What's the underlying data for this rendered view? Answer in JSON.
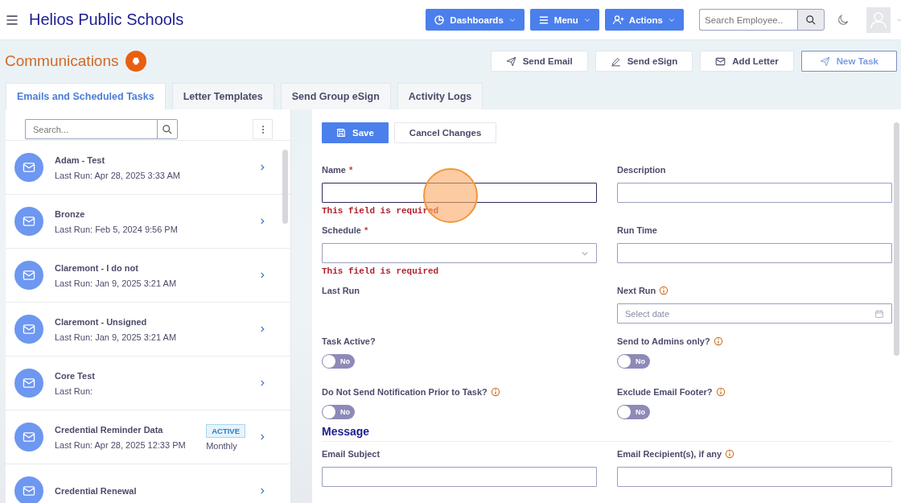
{
  "header": {
    "title": "Helios Public Schools",
    "nav_buttons": [
      {
        "kind": "dashboards",
        "label": "Dashboards"
      },
      {
        "kind": "menu",
        "label": "Menu"
      },
      {
        "kind": "actions",
        "label": "Actions"
      }
    ],
    "search": {
      "placeholder": "Search Employee.."
    }
  },
  "page": {
    "title": "Communications",
    "action_buttons": [
      {
        "kind": "send",
        "label": "Send Email",
        "highlighted": false
      },
      {
        "kind": "sign",
        "label": "Send eSign",
        "highlighted": false
      },
      {
        "kind": "mail",
        "label": "Add Letter",
        "highlighted": false
      },
      {
        "kind": "send",
        "label": "New Task",
        "highlighted": true
      }
    ],
    "tabs": [
      {
        "label": "Emails and Scheduled Tasks",
        "selected": true
      },
      {
        "label": "Letter Templates",
        "selected": false
      },
      {
        "label": "Send Group eSign",
        "selected": false
      },
      {
        "label": "Activity Logs",
        "selected": false
      }
    ]
  },
  "task_list": {
    "search": {
      "placeholder": "Search..."
    },
    "items": [
      {
        "title": "Adam - Test",
        "subtitle": "Last Run: Apr 28, 2025 3:33 AM"
      },
      {
        "title": "Bronze",
        "subtitle": "Last Run: Feb 5, 2024 9:56 PM"
      },
      {
        "title": "Claremont - I do not",
        "subtitle": "Last Run: Jan 9, 2025 3:21 AM"
      },
      {
        "title": "Claremont - Unsigned",
        "subtitle": "Last Run: Jan 9, 2025 3:21 AM"
      },
      {
        "title": "Core Test",
        "subtitle": "Last Run:"
      },
      {
        "title": "Credential Reminder Data",
        "subtitle": "Last Run: Apr 28, 2025 12:33 PM",
        "badge": "ACTIVE",
        "frequency": "Monthly"
      },
      {
        "title": "Credential Renewal"
      }
    ]
  },
  "form": {
    "buttons": [
      {
        "kind": "primary",
        "label": "Save"
      },
      {
        "kind": "secondary",
        "label": "Cancel Changes"
      }
    ],
    "fields": [
      {
        "kind": "text",
        "label": "Name",
        "required_mark": "*",
        "focused": true,
        "error": "This field is required"
      },
      {
        "kind": "text",
        "label": "Description",
        "focused": false
      },
      {
        "kind": "select",
        "label": "Schedule",
        "required_mark": "*",
        "focused": false,
        "error": "This field is required"
      },
      {
        "kind": "text",
        "label": "Run Time",
        "focused": false
      },
      {
        "kind": "none",
        "label": "Last Run"
      },
      {
        "kind": "date",
        "label": "Next Run",
        "info": true,
        "focused": false,
        "placeholder": "Select date"
      },
      {
        "kind": "toggle",
        "label": "Task Active?",
        "on": false,
        "state_label": "No"
      },
      {
        "kind": "toggle",
        "label": "Send to Admins only?",
        "info": true,
        "on": false,
        "state_label": "No"
      },
      {
        "kind": "toggle",
        "label": "Do Not Send Notification Prior to Task?",
        "info": true,
        "on": false,
        "state_label": "No"
      },
      {
        "kind": "toggle",
        "label": "Exclude Email Footer?",
        "info": true,
        "on": false,
        "state_label": "No"
      }
    ],
    "sections": [
      {
        "title": "Message",
        "fields": [
          {
            "kind": "text",
            "label": "Email Subject",
            "focused": false
          },
          {
            "kind": "text",
            "label": "Email Recipient(s), if any",
            "info": true,
            "focused": false
          }
        ]
      }
    ]
  }
}
